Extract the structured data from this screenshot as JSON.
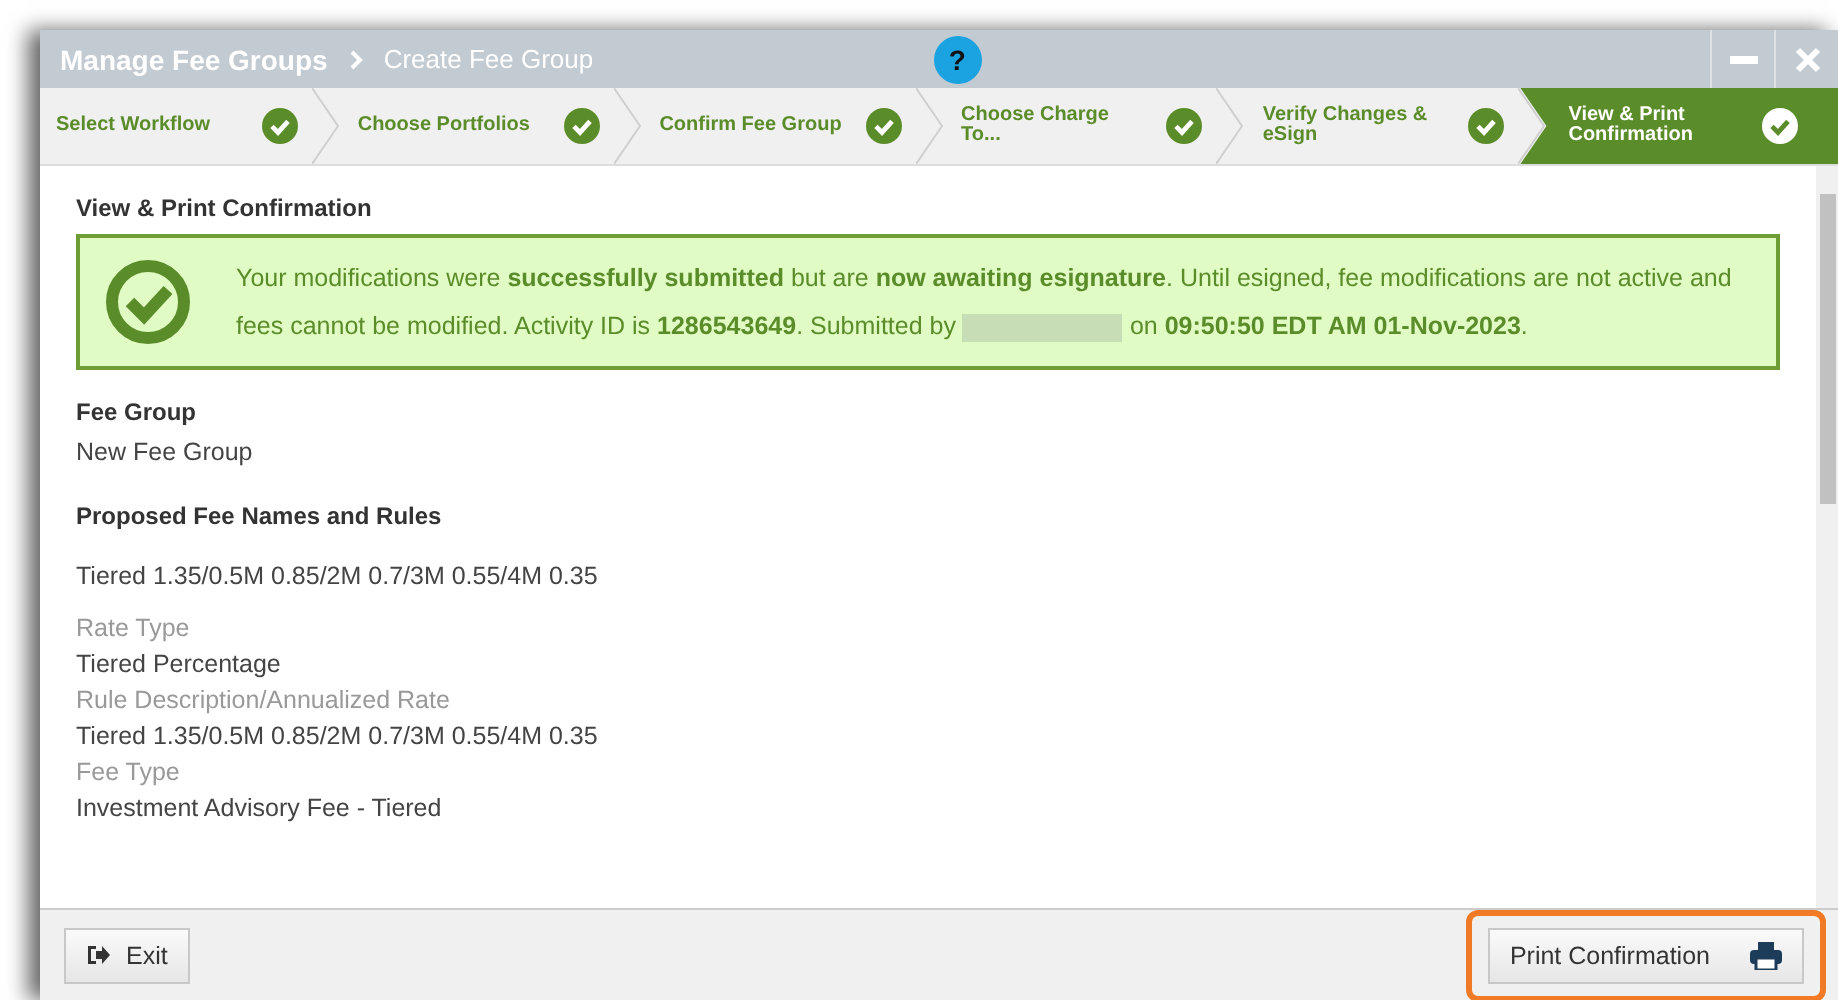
{
  "window": {
    "title": "Manage Fee Groups",
    "subtitle": "Create Fee Group",
    "help": "?"
  },
  "steps": [
    {
      "label": "Select Workflow",
      "done": true,
      "selected": false
    },
    {
      "label": "Choose Portfolios",
      "done": true,
      "selected": false
    },
    {
      "label": "Confirm Fee Group",
      "done": true,
      "selected": false
    },
    {
      "label": "Choose Charge To...",
      "done": true,
      "selected": false
    },
    {
      "label": "Verify Changes & eSign",
      "done": true,
      "selected": false
    },
    {
      "label": "View & Print Confirmation",
      "done": true,
      "selected": true
    }
  ],
  "section_title": "View & Print Confirmation",
  "alert": {
    "text_before": "Your modifications were **successfully submitted** but are **now awaiting esignature**. Until esigned, fee modifications are not active and fees cannot be modified. Activity ID is **1286543649**. Submitted by",
    "text_after": "on **09:50:50 EDT AM 01-Nov-2023**."
  },
  "fee_group": {
    "label": "Fee Group",
    "value": "New Fee Group"
  },
  "rules_title": "Proposed Fee Names and Rules",
  "rule_name": "Tiered 1.35/0.5M 0.85/2M 0.7/3M 0.55/4M 0.35",
  "fields": [
    {
      "label": "Rate Type",
      "value": "Tiered Percentage"
    },
    {
      "label": "Rule Description/Annualized Rate",
      "value": "Tiered 1.35/0.5M 0.85/2M 0.7/3M 0.55/4M 0.35"
    },
    {
      "label": "Fee Type",
      "value": "Investment Advisory Fee - Tiered"
    }
  ],
  "footer": {
    "exit": "Exit",
    "print": "Print Confirmation",
    "print_highlighted": true
  }
}
